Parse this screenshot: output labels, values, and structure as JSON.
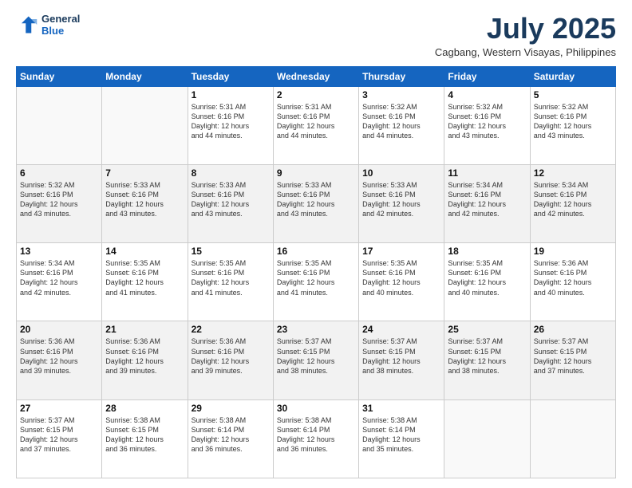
{
  "header": {
    "logo_line1": "General",
    "logo_line2": "Blue",
    "month": "July 2025",
    "location": "Cagbang, Western Visayas, Philippines"
  },
  "weekdays": [
    "Sunday",
    "Monday",
    "Tuesday",
    "Wednesday",
    "Thursday",
    "Friday",
    "Saturday"
  ],
  "weeks": [
    [
      {
        "day": "",
        "info": ""
      },
      {
        "day": "",
        "info": ""
      },
      {
        "day": "1",
        "info": "Sunrise: 5:31 AM\nSunset: 6:16 PM\nDaylight: 12 hours\nand 44 minutes."
      },
      {
        "day": "2",
        "info": "Sunrise: 5:31 AM\nSunset: 6:16 PM\nDaylight: 12 hours\nand 44 minutes."
      },
      {
        "day": "3",
        "info": "Sunrise: 5:32 AM\nSunset: 6:16 PM\nDaylight: 12 hours\nand 44 minutes."
      },
      {
        "day": "4",
        "info": "Sunrise: 5:32 AM\nSunset: 6:16 PM\nDaylight: 12 hours\nand 43 minutes."
      },
      {
        "day": "5",
        "info": "Sunrise: 5:32 AM\nSunset: 6:16 PM\nDaylight: 12 hours\nand 43 minutes."
      }
    ],
    [
      {
        "day": "6",
        "info": "Sunrise: 5:32 AM\nSunset: 6:16 PM\nDaylight: 12 hours\nand 43 minutes."
      },
      {
        "day": "7",
        "info": "Sunrise: 5:33 AM\nSunset: 6:16 PM\nDaylight: 12 hours\nand 43 minutes."
      },
      {
        "day": "8",
        "info": "Sunrise: 5:33 AM\nSunset: 6:16 PM\nDaylight: 12 hours\nand 43 minutes."
      },
      {
        "day": "9",
        "info": "Sunrise: 5:33 AM\nSunset: 6:16 PM\nDaylight: 12 hours\nand 43 minutes."
      },
      {
        "day": "10",
        "info": "Sunrise: 5:33 AM\nSunset: 6:16 PM\nDaylight: 12 hours\nand 42 minutes."
      },
      {
        "day": "11",
        "info": "Sunrise: 5:34 AM\nSunset: 6:16 PM\nDaylight: 12 hours\nand 42 minutes."
      },
      {
        "day": "12",
        "info": "Sunrise: 5:34 AM\nSunset: 6:16 PM\nDaylight: 12 hours\nand 42 minutes."
      }
    ],
    [
      {
        "day": "13",
        "info": "Sunrise: 5:34 AM\nSunset: 6:16 PM\nDaylight: 12 hours\nand 42 minutes."
      },
      {
        "day": "14",
        "info": "Sunrise: 5:35 AM\nSunset: 6:16 PM\nDaylight: 12 hours\nand 41 minutes."
      },
      {
        "day": "15",
        "info": "Sunrise: 5:35 AM\nSunset: 6:16 PM\nDaylight: 12 hours\nand 41 minutes."
      },
      {
        "day": "16",
        "info": "Sunrise: 5:35 AM\nSunset: 6:16 PM\nDaylight: 12 hours\nand 41 minutes."
      },
      {
        "day": "17",
        "info": "Sunrise: 5:35 AM\nSunset: 6:16 PM\nDaylight: 12 hours\nand 40 minutes."
      },
      {
        "day": "18",
        "info": "Sunrise: 5:35 AM\nSunset: 6:16 PM\nDaylight: 12 hours\nand 40 minutes."
      },
      {
        "day": "19",
        "info": "Sunrise: 5:36 AM\nSunset: 6:16 PM\nDaylight: 12 hours\nand 40 minutes."
      }
    ],
    [
      {
        "day": "20",
        "info": "Sunrise: 5:36 AM\nSunset: 6:16 PM\nDaylight: 12 hours\nand 39 minutes."
      },
      {
        "day": "21",
        "info": "Sunrise: 5:36 AM\nSunset: 6:16 PM\nDaylight: 12 hours\nand 39 minutes."
      },
      {
        "day": "22",
        "info": "Sunrise: 5:36 AM\nSunset: 6:16 PM\nDaylight: 12 hours\nand 39 minutes."
      },
      {
        "day": "23",
        "info": "Sunrise: 5:37 AM\nSunset: 6:15 PM\nDaylight: 12 hours\nand 38 minutes."
      },
      {
        "day": "24",
        "info": "Sunrise: 5:37 AM\nSunset: 6:15 PM\nDaylight: 12 hours\nand 38 minutes."
      },
      {
        "day": "25",
        "info": "Sunrise: 5:37 AM\nSunset: 6:15 PM\nDaylight: 12 hours\nand 38 minutes."
      },
      {
        "day": "26",
        "info": "Sunrise: 5:37 AM\nSunset: 6:15 PM\nDaylight: 12 hours\nand 37 minutes."
      }
    ],
    [
      {
        "day": "27",
        "info": "Sunrise: 5:37 AM\nSunset: 6:15 PM\nDaylight: 12 hours\nand 37 minutes."
      },
      {
        "day": "28",
        "info": "Sunrise: 5:38 AM\nSunset: 6:15 PM\nDaylight: 12 hours\nand 36 minutes."
      },
      {
        "day": "29",
        "info": "Sunrise: 5:38 AM\nSunset: 6:14 PM\nDaylight: 12 hours\nand 36 minutes."
      },
      {
        "day": "30",
        "info": "Sunrise: 5:38 AM\nSunset: 6:14 PM\nDaylight: 12 hours\nand 36 minutes."
      },
      {
        "day": "31",
        "info": "Sunrise: 5:38 AM\nSunset: 6:14 PM\nDaylight: 12 hours\nand 35 minutes."
      },
      {
        "day": "",
        "info": ""
      },
      {
        "day": "",
        "info": ""
      }
    ]
  ]
}
